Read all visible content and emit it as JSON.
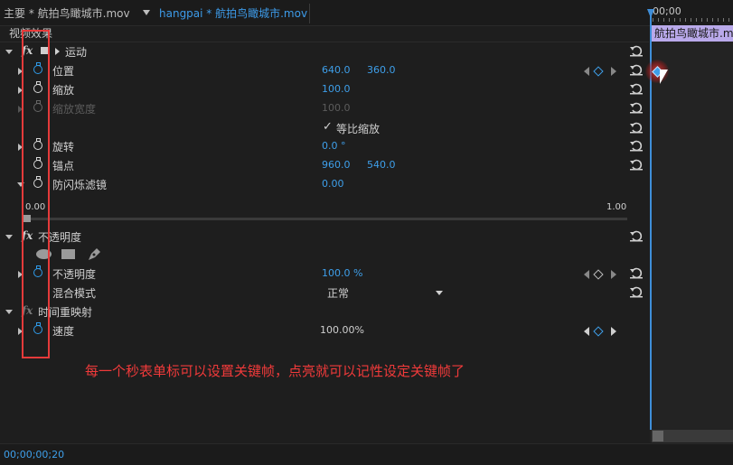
{
  "tabs": {
    "main": "主要 * 航拍鸟瞰城市.mov",
    "sequence": "hangpai * 航拍鸟瞰城市.mov"
  },
  "panel": {
    "title": "视频效果"
  },
  "effects": {
    "motion": {
      "name": "运动",
      "position": {
        "label": "位置",
        "x": "640.0",
        "y": "360.0"
      },
      "scale": {
        "label": "缩放",
        "value": "100.0"
      },
      "scale_width": {
        "label": "缩放宽度",
        "value": "100.0"
      },
      "uniform_scale": {
        "check": "✓",
        "label": "等比缩放"
      },
      "rotation": {
        "label": "旋转",
        "value": "0.0 °"
      },
      "anchor": {
        "label": "锚点",
        "x": "960.0",
        "y": "540.0"
      },
      "antiflicker": {
        "label": "防闪烁滤镜",
        "value": "0.00",
        "min": "0.00",
        "max": "1.00"
      }
    },
    "opacity": {
      "name": "不透明度",
      "opacity": {
        "label": "不透明度",
        "value": "100.0 %"
      },
      "blend": {
        "label": "混合模式",
        "value": "正常"
      }
    },
    "time_remap": {
      "name": "时间重映射",
      "speed": {
        "label": "速度",
        "value": "100.00%"
      }
    }
  },
  "timeline": {
    "time": "00;00",
    "clip_label": "航拍鸟瞰城市.mov"
  },
  "status": {
    "timecode": "00;00;00;20"
  },
  "annotation": "每一个秒表单标可以设置关键帧，点亮就可以记性设定关键帧了",
  "icons": {
    "stopwatch": "stopwatch-icon",
    "reset": "reset-icon",
    "fx": "fx-icon",
    "pen": "pen-icon"
  },
  "colors": {
    "accent": "#3e9fea",
    "annotation": "#e53a3a",
    "clip": "#b9a9ea"
  }
}
